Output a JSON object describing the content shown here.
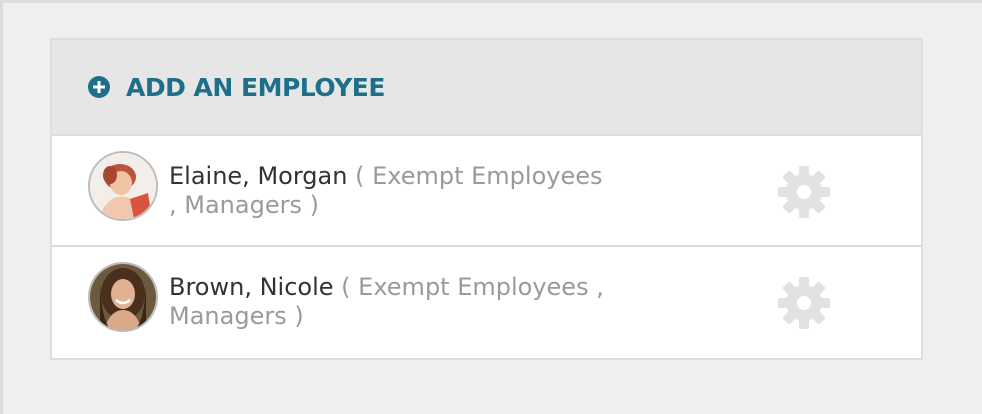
{
  "add_employee": {
    "label": "ADD AN EMPLOYEE",
    "icon": "plus-circle-icon",
    "color": "#1e6f8a"
  },
  "employees": [
    {
      "name": "Elaine, Morgan",
      "groups_line1": "( Exempt Employees",
      "groups_line2": ", Managers )",
      "avatar": "avatar-photo",
      "action_icon": "gear-icon"
    },
    {
      "name": "Brown, Nicole",
      "groups_line1": "( Exempt Employees ,",
      "groups_line2": "Managers )",
      "avatar": "avatar-photo",
      "action_icon": "gear-icon"
    }
  ]
}
